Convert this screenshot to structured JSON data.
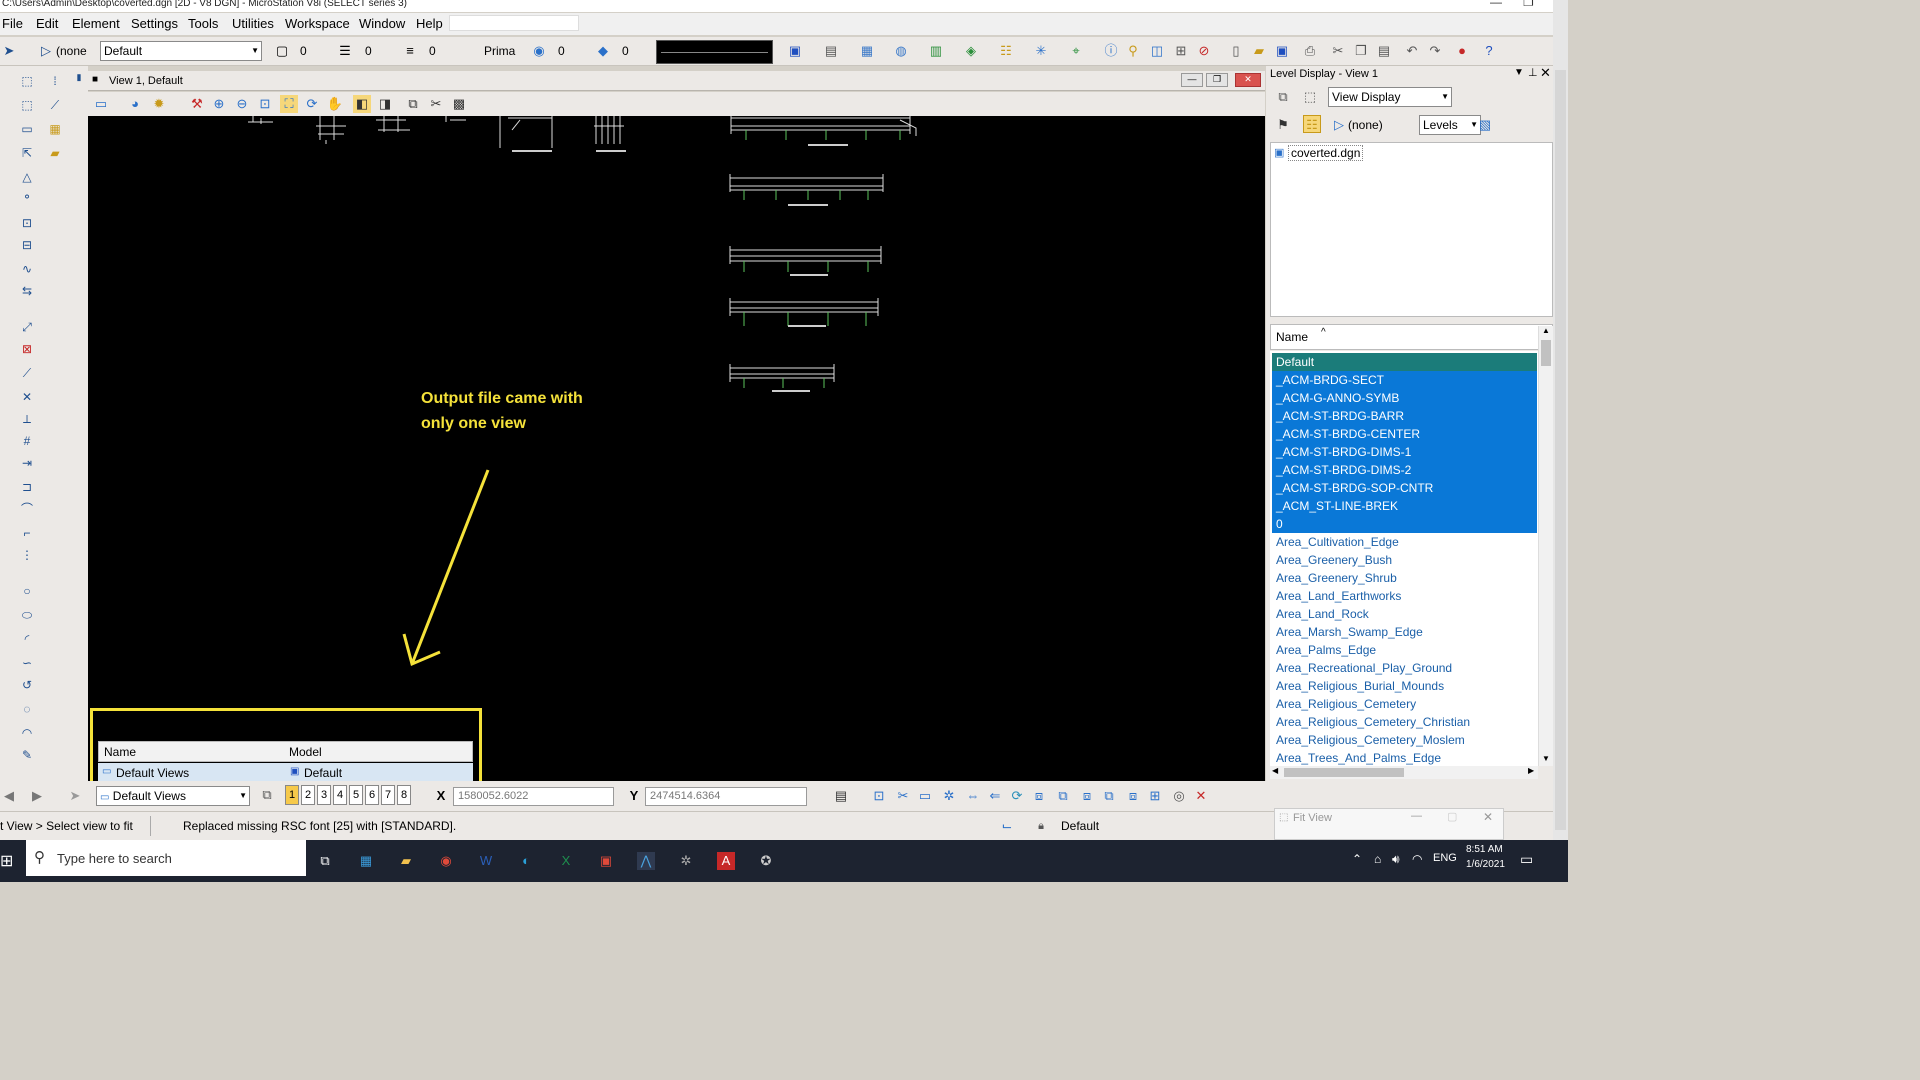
{
  "window": {
    "title": "C:\\Users\\Admin\\Desktop\\coverted.dgn [2D - V8 DGN] - MicroStation V8i (SELECT series 3)"
  },
  "menu": [
    "File",
    "Edit",
    "Element",
    "Settings",
    "Tools",
    "Utilities",
    "Workspace",
    "Window",
    "Help"
  ],
  "toolbar": {
    "active_level_label": "(none",
    "level_value": "Default",
    "color_value": "0",
    "style_value": "0",
    "weight_value": "0",
    "prima_label": "Prima",
    "transparency_value": "0",
    "priority_value": "0"
  },
  "view": {
    "title": "View 1, Default"
  },
  "annotation": {
    "text": "Output file came with\nonly one view"
  },
  "view_groups": {
    "col_name": "Name",
    "col_model": "Model",
    "row_name": "Default Views",
    "row_model": "Default",
    "dropdown_value": "Default Views",
    "view_numbers": [
      "1",
      "2",
      "3",
      "4",
      "5",
      "6",
      "7",
      "8"
    ]
  },
  "coords": {
    "x_label": "X",
    "x_value": "1580052.6022",
    "y_label": "Y",
    "y_value": "2474514.6364"
  },
  "status": {
    "left_text": "t View > Select view to fit",
    "message": "Replaced missing RSC font [25] with [STANDARD].",
    "level_name": "Default"
  },
  "level_display": {
    "title": "Level Display - View 1",
    "mode": "View Display",
    "filter": "(none)",
    "levels_label": "Levels",
    "file": "coverted.dgn",
    "column_name": "Name",
    "levels_selected": [
      "Default",
      "_ACM-BRDG-SECT",
      "_ACM-G-ANNO-SYMB",
      "_ACM-ST-BRDG-BARR",
      "_ACM-ST-BRDG-CENTER",
      "_ACM-ST-BRDG-DIMS-1",
      "_ACM-ST-BRDG-DIMS-2",
      "_ACM-ST-BRDG-SOP-CNTR",
      "_ACM_ST-LINE-BREK",
      "0"
    ],
    "levels_other": [
      "Area_Cultivation_Edge",
      "Area_Greenery_Bush",
      "Area_Greenery_Shrub",
      "Area_Land_Earthworks",
      "Area_Land_Rock",
      "Area_Marsh_Swamp_Edge",
      "Area_Palms_Edge",
      "Area_Recreational_Play_Ground",
      "Area_Religious_Burial_Mounds",
      "Area_Religious_Cemetery",
      "Area_Religious_Cemetery_Christian",
      "Area_Religious_Cemetery_Moslem",
      "Area_Trees_And_Palms_Edge"
    ]
  },
  "fit_view": {
    "title": "Fit View"
  },
  "taskbar": {
    "search_placeholder": "Type here to search",
    "time": "8:51 AM",
    "date": "1/6/2021",
    "lang": "ENG"
  }
}
